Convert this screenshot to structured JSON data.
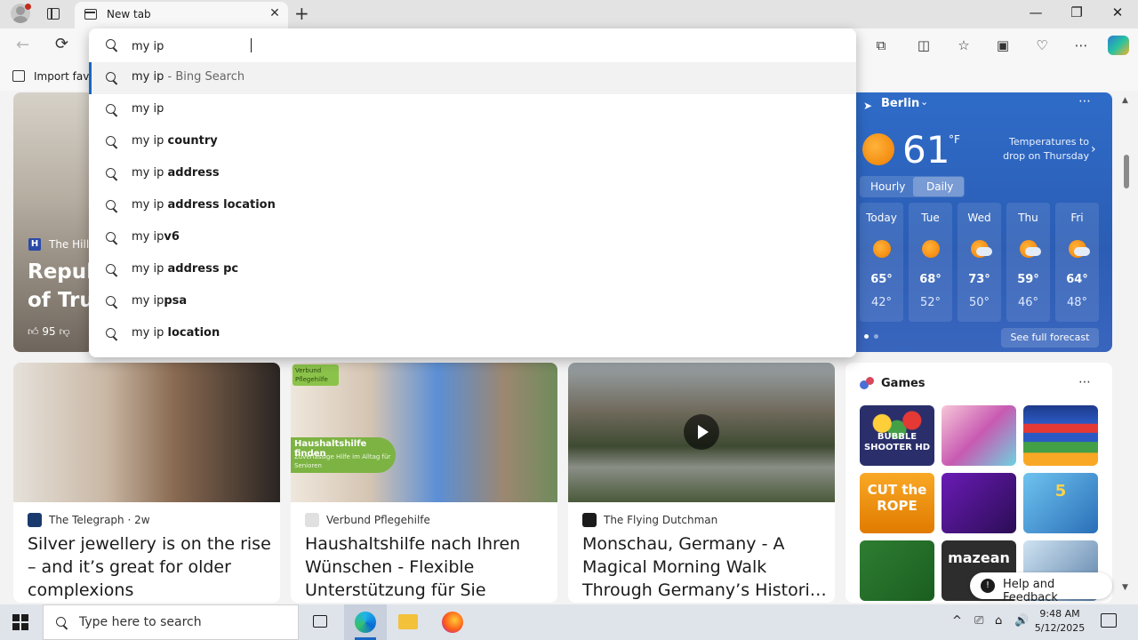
{
  "browser": {
    "tab_title": "New tab",
    "close_tab_glyph": "✕",
    "new_tab_glyph": "+",
    "window_controls": [
      "—",
      "❐",
      "✕"
    ],
    "back_glyph": "←",
    "refresh_glyph": "⟳",
    "toolbar_icons": [
      "extensions-icon",
      "split-screen-icon",
      "favorites-icon",
      "collections-icon",
      "browser-essentials-icon",
      "more-icon"
    ],
    "toolbar_glyphs": [
      "⧉",
      "◫",
      "☆",
      "▣",
      "♡",
      "⋯"
    ],
    "favorites_bar_label": "Import favo"
  },
  "omnibox": {
    "query": "my ip",
    "suggestions": [
      {
        "prefix": "my ip",
        "bold": "",
        "meta": " - Bing Search",
        "selected": true
      },
      {
        "prefix": "my ip",
        "bold": "",
        "meta": "",
        "selected": false
      },
      {
        "prefix": "my ip ",
        "bold": "country",
        "meta": "",
        "selected": false
      },
      {
        "prefix": "my ip ",
        "bold": "address",
        "meta": "",
        "selected": false
      },
      {
        "prefix": "my ip ",
        "bold": "address location",
        "meta": "",
        "selected": false
      },
      {
        "prefix": "my ip",
        "bold": "v6",
        "meta": "",
        "selected": false
      },
      {
        "prefix": "my ip ",
        "bold": "address pc",
        "meta": "",
        "selected": false
      },
      {
        "prefix": "my ip",
        "bold": "psa",
        "meta": "",
        "selected": false
      },
      {
        "prefix": "my ip ",
        "bold": "location",
        "meta": "",
        "selected": false
      }
    ]
  },
  "hero": {
    "source": "The Hill",
    "source_icon_letter": "H",
    "title_lines": [
      "Repub",
      "of Trur"
    ],
    "likes": "95"
  },
  "weather": {
    "city": "Berlin",
    "temperature": "61",
    "unit": "°F",
    "alert": "Temperatures to drop on Thursday",
    "tabs": [
      "Hourly",
      "Daily"
    ],
    "active_tab": "Daily",
    "days": [
      {
        "name": "Today",
        "icon": "sunny-icon",
        "hi": "65°",
        "lo": "42°"
      },
      {
        "name": "Tue",
        "icon": "sunny-icon",
        "hi": "68°",
        "lo": "52°"
      },
      {
        "name": "Wed",
        "icon": "partly-cloudy-icon",
        "hi": "73°",
        "lo": "50°"
      },
      {
        "name": "Thu",
        "icon": "partly-cloudy-icon",
        "hi": "59°",
        "lo": "46°"
      },
      {
        "name": "Fri",
        "icon": "partly-cloudy-icon",
        "hi": "64°",
        "lo": "48°"
      }
    ],
    "forecast_link": "See full forecast",
    "more_glyph": "⋯"
  },
  "cards": [
    {
      "source": "The Telegraph",
      "time": "2w",
      "title": "Silver jewellery is on the rise – and it’s great for older complexions",
      "icon_color": "#1a3a6e"
    },
    {
      "source": "Verbund Pflegehilfe",
      "time": "",
      "title": "Haushaltshilfe nach Ihren Wünschen - Flexible Unterstützung für Sie",
      "icon_color": "#9aa0a6",
      "ad_badge": "Verbund Pflegehilfe",
      "ad_heading": "Haushaltshilfe finden",
      "ad_sub": "Zuverlässige Hilfe im Alltag für Senioren"
    },
    {
      "source": "The Flying Dutchman",
      "time": "",
      "title": "Monschau, Germany - A Magical Morning Walk Through Germany’s Histori…",
      "icon_color": "#1b1b1b"
    }
  ],
  "games": {
    "title": "Games",
    "more_glyph": "⋯",
    "tiles": [
      "BUBBLE SHOOTER HD",
      "",
      "",
      "CUT the ROPE",
      "",
      "5",
      "",
      "mazean",
      ""
    ]
  },
  "help": {
    "label": "Help and Feedback"
  },
  "taskbar": {
    "search_placeholder": "Type here to search",
    "time": "9:48 AM",
    "date": "5/12/2025",
    "tray_glyphs": [
      "^",
      "⎚",
      "⌂",
      "🔊"
    ]
  }
}
